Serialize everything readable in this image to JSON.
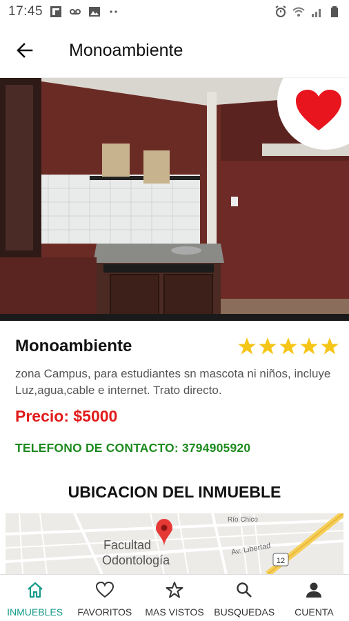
{
  "status_bar": {
    "time": "17:45"
  },
  "app_bar": {
    "title": "Monoambiente"
  },
  "listing": {
    "title": "Monoambiente",
    "rating": 5,
    "description": " zona Campus, para estudiantes sn mascota ni niños, incluye Luz,agua,cable e internet. Trato directo.",
    "price": "Precio: $5000",
    "phone": "TELEFONO DE CONTACTO: 3794905920",
    "is_favorite": true
  },
  "location": {
    "section_title": "UBICACION DEL INMUEBLE",
    "map_labels": {
      "place": "Facultad",
      "place2": "Odontología",
      "street": "Av. Libertad",
      "river": "Río Chico",
      "route": "12"
    }
  },
  "bottom_nav": {
    "items": [
      {
        "label": "INMUEBLES",
        "icon": "home-icon",
        "active": true
      },
      {
        "label": "FAVORITOS",
        "icon": "heart-outline-icon",
        "active": false
      },
      {
        "label": "MAS VISTOS",
        "icon": "star-outline-icon",
        "active": false
      },
      {
        "label": "BUSQUEDAS",
        "icon": "search-icon",
        "active": false
      },
      {
        "label": "CUENTA",
        "icon": "person-icon",
        "active": false
      }
    ]
  },
  "colors": {
    "accent": "#159a8a",
    "price": "#e21a1a",
    "phone": "#1e8a1e",
    "star": "#f5c518",
    "heart": "#e8141e"
  }
}
